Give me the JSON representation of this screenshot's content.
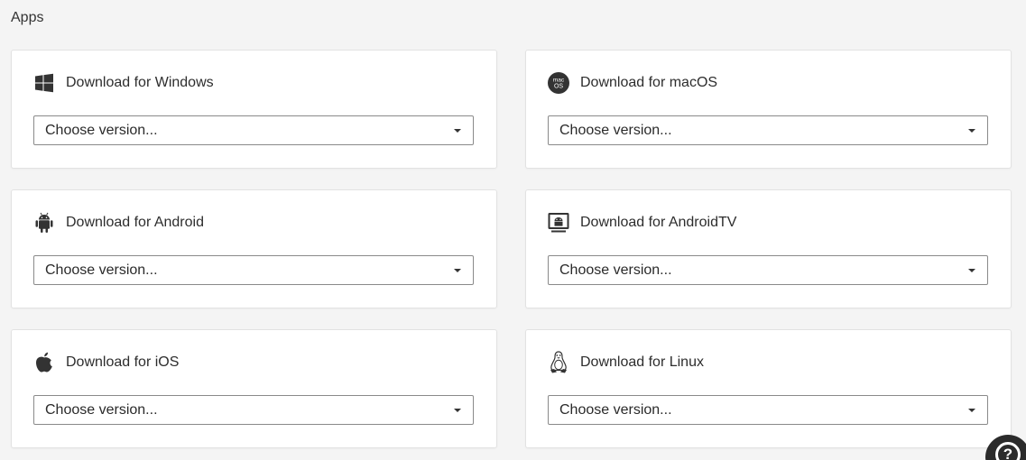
{
  "section": {
    "title": "Apps"
  },
  "cards": [
    {
      "title": "Download for Windows",
      "icon": "windows-icon",
      "select": "Choose version..."
    },
    {
      "title": "Download for macOS",
      "icon": "macos-icon",
      "icon_text": "mac OS",
      "select": "Choose version..."
    },
    {
      "title": "Download for Android",
      "icon": "android-icon",
      "select": "Choose version..."
    },
    {
      "title": "Download for AndroidTV",
      "icon": "android-tv-icon",
      "select": "Choose version..."
    },
    {
      "title": "Download for iOS",
      "icon": "apple-icon",
      "select": "Choose version..."
    },
    {
      "title": "Download for Linux",
      "icon": "linux-tux-icon",
      "select": "Choose version..."
    }
  ],
  "help": {
    "label": "?",
    "icon": "help-icon"
  },
  "colors": {
    "background": "#f4f4f4",
    "card": "#ffffff",
    "border": "#e2e2e2",
    "icon": "#333333",
    "help": "#2b2b2b"
  }
}
